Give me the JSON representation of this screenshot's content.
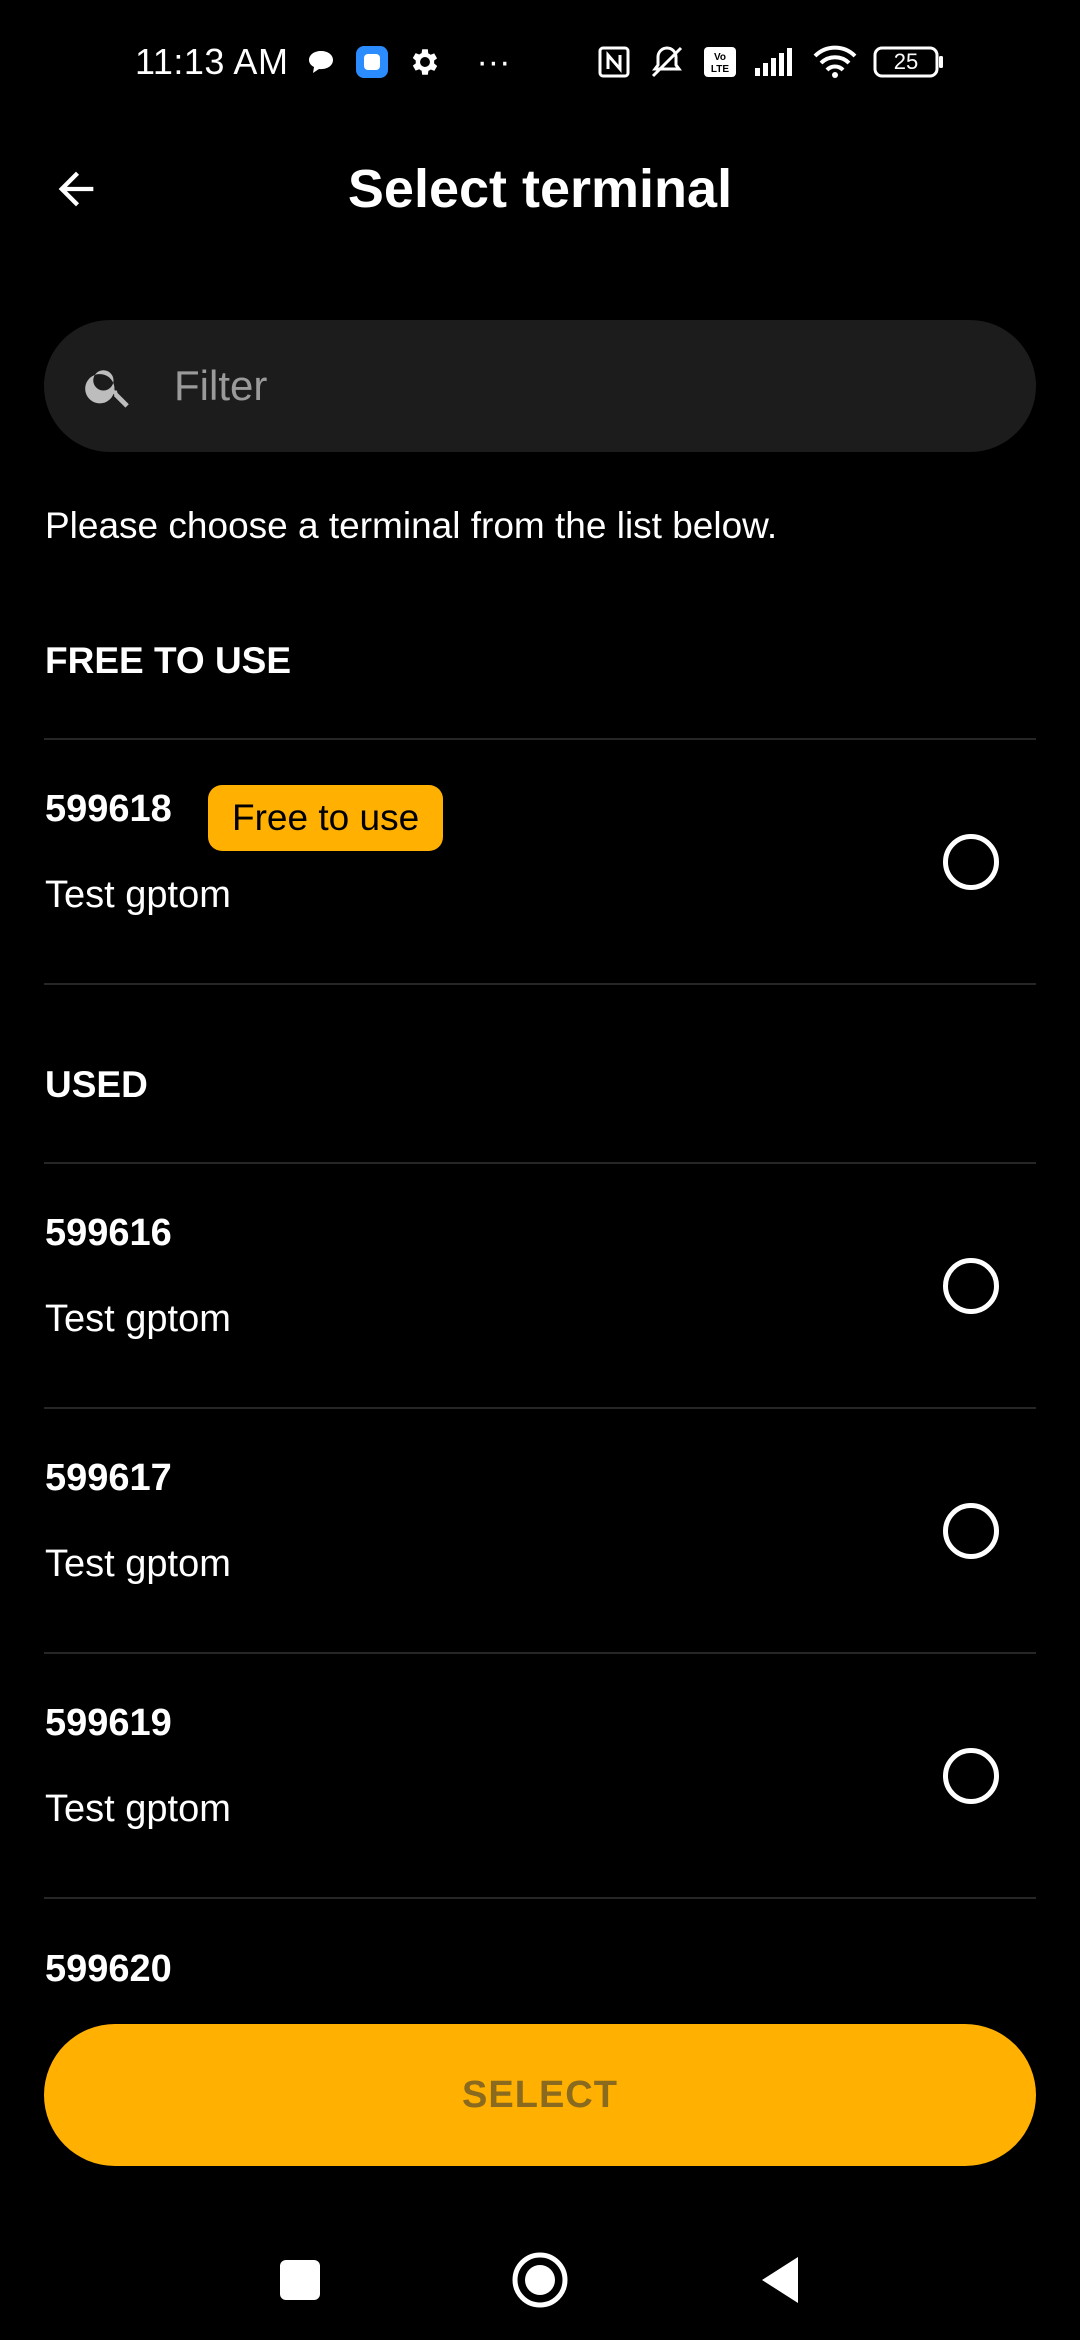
{
  "status_bar": {
    "time": "11:13 AM",
    "more": "···",
    "battery": "25",
    "icons": [
      "chat-bubble-icon",
      "app-icon",
      "settings-icon",
      "nfc-icon",
      "mute-icon",
      "volte-icon",
      "signal-icon",
      "wifi-icon",
      "battery-icon"
    ]
  },
  "header": {
    "title": "Select terminal",
    "back_icon": "arrow-left-icon"
  },
  "search": {
    "placeholder": "Filter",
    "value": ""
  },
  "instructions": "Please choose a terminal from the list below.",
  "sections": {
    "free": {
      "title": "FREE TO USE",
      "items": [
        {
          "id": "599618",
          "name": "Test gptom",
          "badge": "Free to use",
          "selected": false
        }
      ]
    },
    "used": {
      "title": "USED",
      "items": [
        {
          "id": "599616",
          "name": "Test gptom",
          "selected": false
        },
        {
          "id": "599617",
          "name": "Test gptom",
          "selected": false
        },
        {
          "id": "599619",
          "name": "Test gptom",
          "selected": false
        },
        {
          "id": "599620",
          "name": "",
          "selected": false
        }
      ]
    }
  },
  "select_button": "SELECT",
  "colors": {
    "accent": "#ffb000",
    "background": "#000000",
    "surface": "#1c1c1c"
  }
}
